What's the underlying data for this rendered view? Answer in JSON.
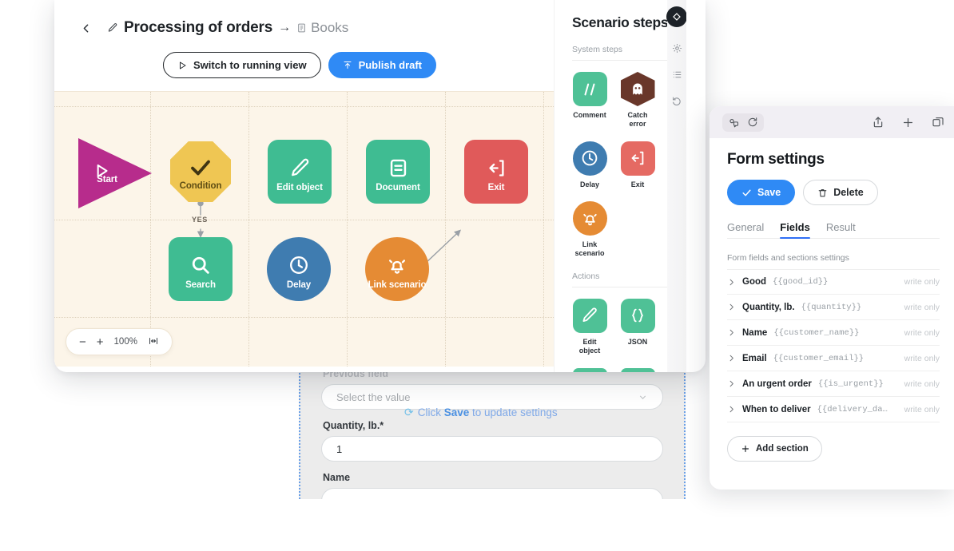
{
  "editor": {
    "title": "Processing of orders",
    "arrow": "→",
    "subtitle": "Books",
    "back_icon": "chevron-left-icon",
    "edit_icon": "pencil-icon",
    "book_icon": "book-icon",
    "buttons": {
      "switch_view": "Switch to running view",
      "publish": "Publish draft"
    },
    "zoom_bar": {
      "minus": "−",
      "plus": "+",
      "level": "100%",
      "fit": "fit-to-screen-icon"
    }
  },
  "canvas": {
    "background": "#FCF5E9",
    "yes_label": "YES",
    "nodes": [
      {
        "id": "start",
        "label": "Start",
        "shape": "triangle",
        "color": "#B72C8C",
        "icon": "play-icon"
      },
      {
        "id": "condition",
        "label": "Condition",
        "shape": "octagon",
        "color": "#EFC653",
        "icon": "check-icon"
      },
      {
        "id": "edit_object",
        "label": "Edit object",
        "shape": "square",
        "color": "#3FBC92",
        "icon": "pencil-icon"
      },
      {
        "id": "document",
        "label": "Document",
        "shape": "square",
        "color": "#3FBC92",
        "icon": "document-icon"
      },
      {
        "id": "exit",
        "label": "Exit",
        "shape": "square",
        "color": "#E05A5A",
        "icon": "exit-icon"
      },
      {
        "id": "search",
        "label": "Search",
        "shape": "square",
        "color": "#3FBC92",
        "icon": "magnifier-icon"
      },
      {
        "id": "delay",
        "label": "Delay",
        "shape": "circle",
        "color": "#3F7CB0",
        "icon": "clock-icon"
      },
      {
        "id": "link_scenario",
        "label": "Link scenario",
        "shape": "circle",
        "color": "#E58B34",
        "icon": "bell-icon"
      }
    ]
  },
  "steps_panel": {
    "title": "Scenario steps",
    "groups": [
      {
        "label": "System steps",
        "items": [
          {
            "label": "Comment",
            "icon": "slashes-icon",
            "color": "#4FC196",
            "shape": "rounded"
          },
          {
            "label": "Catch\nerror",
            "icon": "ghost-icon",
            "color": "#69372A",
            "shape": "hex"
          },
          {
            "label": "Delay",
            "icon": "clock-icon",
            "color": "#3F7CB0",
            "shape": "round"
          },
          {
            "label": "Exit",
            "icon": "exit-icon",
            "color": "#E56A63",
            "shape": "rounded"
          },
          {
            "label": "Link\nscenario",
            "icon": "bell-icon",
            "color": "#E58B34",
            "shape": "round"
          }
        ]
      },
      {
        "label": "Actions",
        "items": [
          {
            "label": "Edit\nobject",
            "icon": "pencil-icon",
            "color": "#4FC196",
            "shape": "rounded"
          },
          {
            "label": "JSON",
            "icon": "braces-icon",
            "color": "#4FC196",
            "shape": "rounded"
          }
        ]
      }
    ]
  },
  "vtoolbar": {
    "items": [
      {
        "icon": "diamond-icon",
        "active": true
      },
      {
        "icon": "gear-icon",
        "active": false
      },
      {
        "icon": "list-icon",
        "active": false
      },
      {
        "icon": "undo-icon",
        "active": false
      }
    ]
  },
  "form_preview": {
    "faded_label": "Previous field",
    "select_placeholder": "Select the value",
    "chevron_icon": "chevron-down-icon",
    "hint_icon": "sync-icon",
    "hint_before": "Click ",
    "hint_bold": "Save",
    "hint_after": " to update settings",
    "quantity_label": "Quantity, lb.*",
    "quantity_value": "1",
    "name_label": "Name"
  },
  "form_settings": {
    "chrome": {
      "left_icons": [
        "extensions-icon",
        "reload-icon"
      ],
      "right_icons": [
        "share-icon",
        "new-tab-icon",
        "tabs-icon"
      ]
    },
    "title": "Form settings",
    "save_label": "Save",
    "save_icon": "check-icon",
    "delete_label": "Delete",
    "delete_icon": "trash-icon",
    "tabs": [
      {
        "label": "General",
        "active": false
      },
      {
        "label": "Fields",
        "active": true
      },
      {
        "label": "Result",
        "active": false
      }
    ],
    "section_label": "Form fields and sections settings",
    "fields": [
      {
        "name": "Good",
        "variable": "{{good_id}}",
        "mode": "write only"
      },
      {
        "name": "Quantity, lb.",
        "variable": "{{quantity}}",
        "mode": "write only"
      },
      {
        "name": "Name",
        "variable": "{{customer_name}}",
        "mode": "write only"
      },
      {
        "name": "Email",
        "variable": "{{customer_email}}",
        "mode": "write only"
      },
      {
        "name": "An urgent order",
        "variable": "{{is_urgent}}",
        "mode": "write only"
      },
      {
        "name": "When to deliver",
        "variable": "{{delivery_da…",
        "mode": "write only"
      }
    ],
    "add_section_label": "Add section",
    "add_icon": "plus-icon",
    "accent": "#2F8AF5"
  }
}
